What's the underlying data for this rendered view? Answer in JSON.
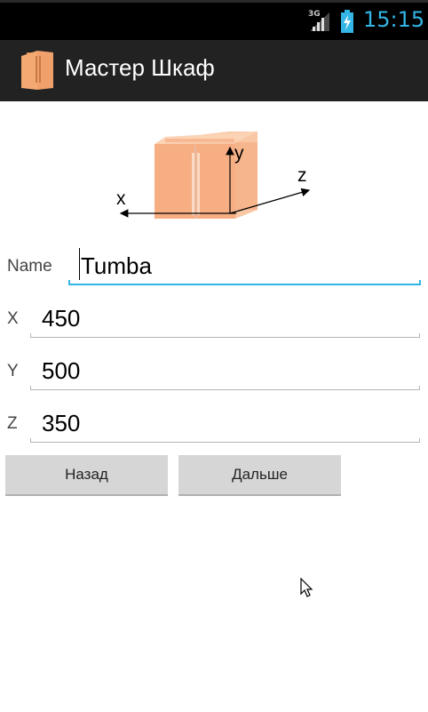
{
  "status_bar": {
    "network": "3G",
    "time": "15:15",
    "time_color": "#33b5e5"
  },
  "action_bar": {
    "title": "Мастер Шкаф",
    "icon": "cabinet-icon",
    "background": "#222222"
  },
  "diagram": {
    "axis_x": "x",
    "axis_y": "y",
    "axis_z": "z"
  },
  "form": {
    "name": {
      "label": "Name",
      "value": "Tumba"
    },
    "x": {
      "label": "X",
      "value": "450"
    },
    "y": {
      "label": "Y",
      "value": "500"
    },
    "z": {
      "label": "Z",
      "value": "350"
    }
  },
  "buttons": {
    "back": "Назад",
    "next": "Дальше"
  },
  "accent_color": "#33b5e5"
}
